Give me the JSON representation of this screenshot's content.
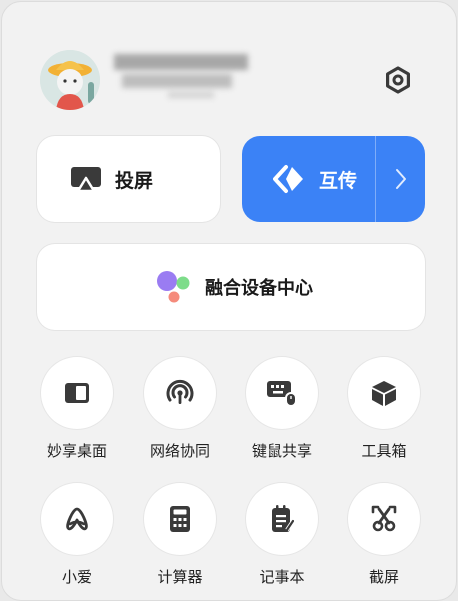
{
  "header": {
    "avatar_icon": "avatar-icon",
    "settings_icon": "gear-icon"
  },
  "cast": {
    "label": "投屏",
    "icon": "screen-cast-icon"
  },
  "relay": {
    "label": "互传",
    "icon": "relay-logo-icon",
    "arrow_icon": "chevron-right-icon"
  },
  "fusion": {
    "label": "融合设备中心",
    "icon": "fusion-dots-icon"
  },
  "tiles": [
    {
      "label": "妙享桌面",
      "icon": "desktop-panel-icon"
    },
    {
      "label": "网络协同",
      "icon": "network-signal-icon"
    },
    {
      "label": "键鼠共享",
      "icon": "keyboard-mouse-icon"
    },
    {
      "label": "工具箱",
      "icon": "toolbox-cube-icon"
    },
    {
      "label": "小爱",
      "icon": "xiaoai-icon"
    },
    {
      "label": "计算器",
      "icon": "calculator-icon"
    },
    {
      "label": "记事本",
      "icon": "notepad-icon"
    },
    {
      "label": "截屏",
      "icon": "screenshot-scissors-icon"
    }
  ],
  "colors": {
    "accent": "#3b82f6",
    "panel": "#f2f2f2",
    "card": "#ffffff"
  }
}
